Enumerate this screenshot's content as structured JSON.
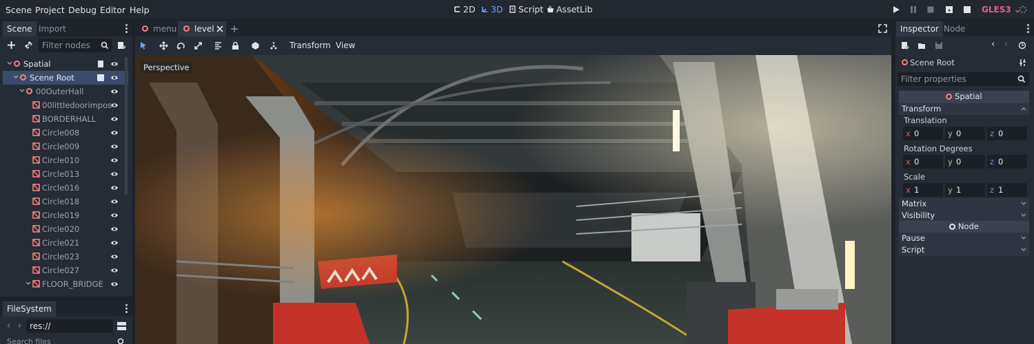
{
  "menubar": {
    "items": [
      "Scene",
      "Project",
      "Debug",
      "Editor",
      "Help"
    ]
  },
  "workspaces": {
    "two_d": "2D",
    "three_d": "3D",
    "script": "Script",
    "assetlib": "AssetLib"
  },
  "renderer": {
    "label": "GLES3"
  },
  "left_dock": {
    "tabs": [
      "Scene",
      "Import"
    ],
    "filter_placeholder": "Filter nodes",
    "tree": [
      {
        "label": "Spatial",
        "depth": 0,
        "icon": "spatial-icon",
        "expanded": true
      },
      {
        "label": "Scene Root",
        "depth": 1,
        "icon": "spatial-icon",
        "expanded": true,
        "selected": true
      },
      {
        "label": "00OuterHall",
        "depth": 2,
        "icon": "spatial-icon",
        "expanded": true
      },
      {
        "label": "00littledoorimpos",
        "depth": 3,
        "icon": "mesh-instance-icon"
      },
      {
        "label": "BORDERHALL",
        "depth": 3,
        "icon": "mesh-instance-icon"
      },
      {
        "label": "Circle008",
        "depth": 3,
        "icon": "mesh-instance-icon"
      },
      {
        "label": "Circle009",
        "depth": 3,
        "icon": "mesh-instance-icon"
      },
      {
        "label": "Circle010",
        "depth": 3,
        "icon": "mesh-instance-icon"
      },
      {
        "label": "Circle013",
        "depth": 3,
        "icon": "mesh-instance-icon"
      },
      {
        "label": "Circle016",
        "depth": 3,
        "icon": "mesh-instance-icon"
      },
      {
        "label": "Circle018",
        "depth": 3,
        "icon": "mesh-instance-icon"
      },
      {
        "label": "Circle019",
        "depth": 3,
        "icon": "mesh-instance-icon"
      },
      {
        "label": "Circle020",
        "depth": 3,
        "icon": "mesh-instance-icon"
      },
      {
        "label": "Circle021",
        "depth": 3,
        "icon": "mesh-instance-icon"
      },
      {
        "label": "Circle023",
        "depth": 3,
        "icon": "mesh-instance-icon"
      },
      {
        "label": "Circle027",
        "depth": 3,
        "icon": "mesh-instance-icon"
      },
      {
        "label": "FLOOR_BRIDGE",
        "depth": 3,
        "icon": "mesh-instance-icon",
        "expanded": true
      }
    ]
  },
  "filesystem": {
    "title": "FileSystem",
    "path": "res://",
    "search_placeholder": "Search files"
  },
  "editor_tabs": [
    {
      "label": "menu"
    },
    {
      "label": "level",
      "current": true
    }
  ],
  "viewport_toolbar": {
    "transform_menu": "Transform",
    "view_menu": "View"
  },
  "viewport": {
    "perspective_label": "Perspective"
  },
  "inspector": {
    "tabs": [
      "Inspector",
      "Node"
    ],
    "node_name": "Scene Root",
    "filter_placeholder": "Filter properties",
    "class_header": "Spatial",
    "transform_section": "Transform",
    "translation": {
      "label": "Translation",
      "x": "0",
      "y": "0",
      "z": "0"
    },
    "rotation": {
      "label": "Rotation Degrees",
      "x": "0",
      "y": "0",
      "z": "0"
    },
    "scale": {
      "label": "Scale",
      "x": "1",
      "y": "1",
      "z": "1"
    },
    "axis_labels": {
      "x": "x",
      "y": "y",
      "z": "z"
    },
    "matrix_section": "Matrix",
    "visibility_section": "Visibility",
    "node_header": "Node",
    "pause_section": "Pause",
    "script_section": "Script"
  },
  "colors": {
    "accent": "#6ea6ff",
    "spatial_node": "#fc7f7f",
    "renderer_label": "#e85d8c",
    "selection": "#3a4c6a"
  }
}
